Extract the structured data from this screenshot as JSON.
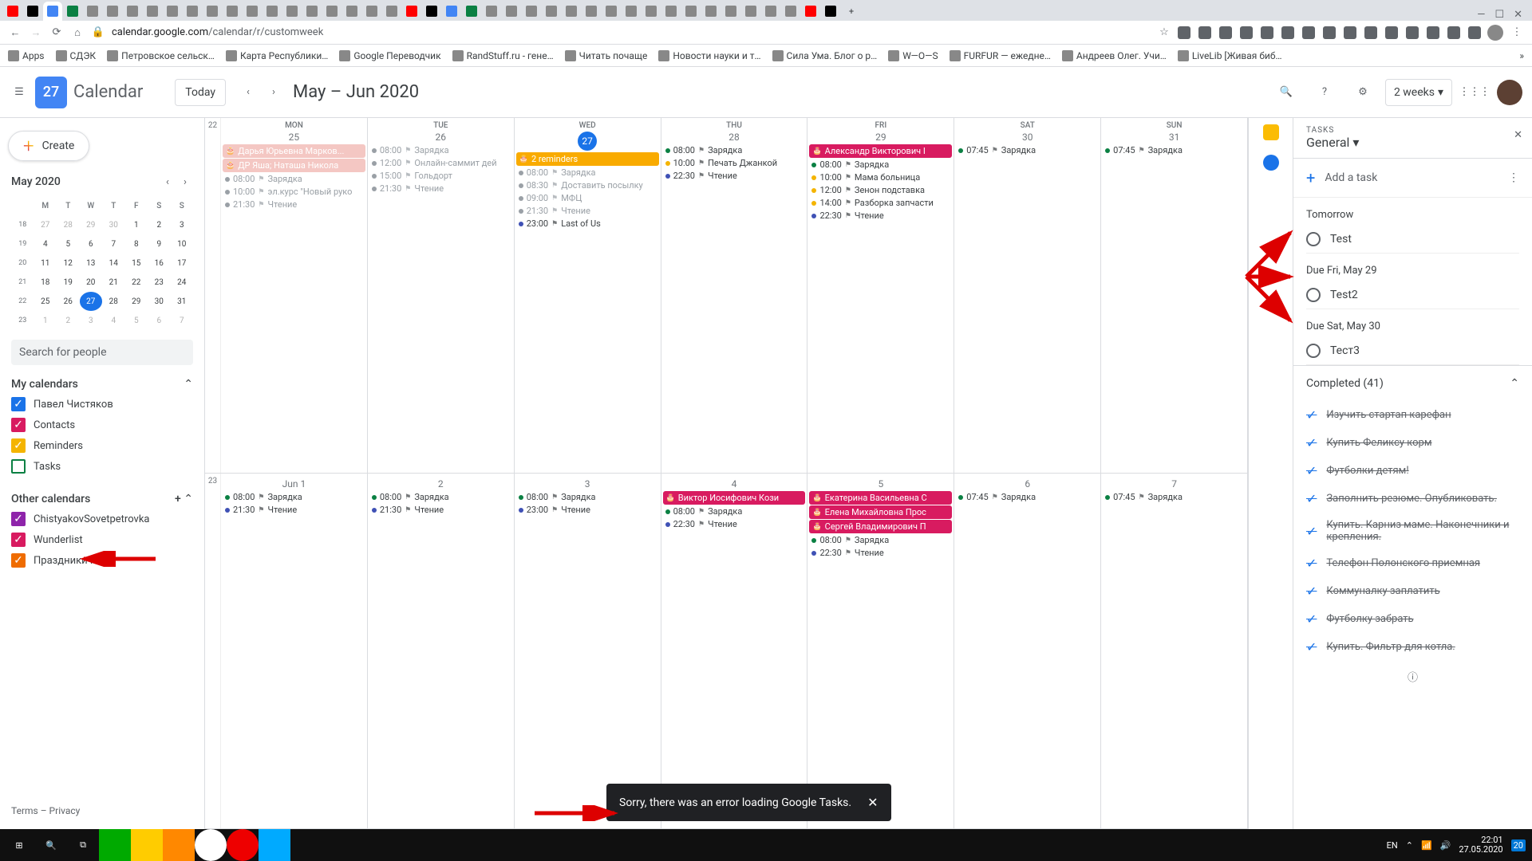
{
  "browser": {
    "url_prefix": "calendar.google.com",
    "url_path": "/calendar/r/customweek",
    "active_tab": "27",
    "addr_icons_count": 15,
    "tab_count": 42
  },
  "bookmarks": [
    "Apps",
    "СДЭК",
    "Петровское сельск…",
    "Карта Республики…",
    "Google Переводчик",
    "RandStuff.ru - гене…",
    "Читать почаще",
    "Новости науки и т…",
    "Сила Ума. Блог о р…",
    "W—O—S",
    "FURFUR — ежедне…",
    "Андреев Олег. Учи…",
    "LiveLib [Живая биб…"
  ],
  "header": {
    "app_title": "Calendar",
    "logo_num": "27",
    "today": "Today",
    "range": "May – Jun 2020",
    "view": "2 weeks"
  },
  "sidebar": {
    "create": "Create",
    "mini_title": "May 2020",
    "dows": [
      "M",
      "T",
      "W",
      "T",
      "F",
      "S",
      "S"
    ],
    "weeks": [
      {
        "wk": "18",
        "days": [
          "27",
          "28",
          "29",
          "30",
          "1",
          "2",
          "3"
        ],
        "muted": [
          0,
          1,
          2,
          3
        ]
      },
      {
        "wk": "19",
        "days": [
          "4",
          "5",
          "6",
          "7",
          "8",
          "9",
          "10"
        ]
      },
      {
        "wk": "20",
        "days": [
          "11",
          "12",
          "13",
          "14",
          "15",
          "16",
          "17"
        ]
      },
      {
        "wk": "21",
        "days": [
          "18",
          "19",
          "20",
          "21",
          "22",
          "23",
          "24"
        ]
      },
      {
        "wk": "22",
        "days": [
          "25",
          "26",
          "27",
          "28",
          "29",
          "30",
          "31"
        ],
        "today": 2
      },
      {
        "wk": "23",
        "days": [
          "1",
          "2",
          "3",
          "4",
          "5",
          "6",
          "7"
        ],
        "muted": [
          0,
          1,
          2,
          3,
          4,
          5,
          6
        ]
      }
    ],
    "search": "Search for people",
    "my_cal_hdr": "My calendars",
    "my_cals": [
      {
        "label": "Павел Чистяков",
        "color": "#1a73e8",
        "checked": true
      },
      {
        "label": "Contacts",
        "color": "#d81b60",
        "checked": true
      },
      {
        "label": "Reminders",
        "color": "#f4b400",
        "checked": true
      },
      {
        "label": "Tasks",
        "color": "#0b8043",
        "checked": false
      }
    ],
    "other_hdr": "Other calendars",
    "other_cals": [
      {
        "label": "ChistyakovSovetpetrovka",
        "color": "#8e24aa",
        "checked": true
      },
      {
        "label": "Wunderlist",
        "color": "#d81b60",
        "checked": true
      },
      {
        "label": "Праздники РФ",
        "color": "#ef6c00",
        "checked": true
      }
    ],
    "footer": "Terms – Privacy"
  },
  "calendar": {
    "week1": {
      "wk": "22",
      "days": [
        {
          "dow": "MON",
          "num": "25",
          "today": false,
          "events": [
            {
              "type": "chip",
              "color": "#f4c7c3",
              "text": "Дарья Юрьевна Марков..."
            },
            {
              "type": "chip",
              "color": "#f4c7c3",
              "text": "ДР Яша; Наташа Никола"
            },
            {
              "type": "dot",
              "dot": "#9aa0a6",
              "time": "08:00",
              "text": "Зарядка",
              "past": true
            },
            {
              "type": "dot",
              "dot": "#9aa0a6",
              "time": "10:00",
              "text": "эл.курс \"Новый руко",
              "past": true
            },
            {
              "type": "dot",
              "dot": "#9aa0a6",
              "time": "21:30",
              "text": "Чтение",
              "past": true
            }
          ]
        },
        {
          "dow": "TUE",
          "num": "26",
          "events": [
            {
              "type": "dot",
              "dot": "#9aa0a6",
              "time": "08:00",
              "text": "Зарядка",
              "past": true
            },
            {
              "type": "dot",
              "dot": "#9aa0a6",
              "time": "12:00",
              "text": "Онлайн-саммит дей",
              "past": true
            },
            {
              "type": "dot",
              "dot": "#9aa0a6",
              "time": "15:00",
              "text": "Гольдорт",
              "past": true
            },
            {
              "type": "dot",
              "dot": "#9aa0a6",
              "time": "21:30",
              "text": "Чтение",
              "past": true
            }
          ]
        },
        {
          "dow": "WED",
          "num": "27",
          "today": true,
          "events": [
            {
              "type": "chip",
              "color": "#f9ab00",
              "text": "2 reminders"
            },
            {
              "type": "dot",
              "dot": "#9aa0a6",
              "time": "08:00",
              "text": "Зарядка",
              "past": true
            },
            {
              "type": "dot",
              "dot": "#9aa0a6",
              "time": "08:30",
              "text": "Доставить посылку",
              "past": true
            },
            {
              "type": "dot",
              "dot": "#9aa0a6",
              "time": "09:00",
              "text": "МФЦ",
              "past": true
            },
            {
              "type": "dot",
              "dot": "#9aa0a6",
              "time": "21:30",
              "text": "Чтение",
              "past": true
            },
            {
              "type": "dot",
              "dot": "#3f51b5",
              "time": "23:00",
              "text": "Last of Us"
            }
          ]
        },
        {
          "dow": "THU",
          "num": "28",
          "events": [
            {
              "type": "dot",
              "dot": "#0b8043",
              "time": "08:00",
              "text": "Зарядка"
            },
            {
              "type": "dot",
              "dot": "#f4b400",
              "time": "10:00",
              "text": "Печать Джанкой"
            },
            {
              "type": "dot",
              "dot": "#3f51b5",
              "time": "22:30",
              "text": "Чтение"
            }
          ]
        },
        {
          "dow": "FRI",
          "num": "29",
          "events": [
            {
              "type": "chip",
              "color": "#d81b60",
              "text": "Александр Викторович I"
            },
            {
              "type": "dot",
              "dot": "#0b8043",
              "time": "08:00",
              "text": "Зарядка"
            },
            {
              "type": "dot",
              "dot": "#f4b400",
              "time": "10:00",
              "text": "Мама больница"
            },
            {
              "type": "dot",
              "dot": "#f4b400",
              "time": "12:00",
              "text": "Зенон подставка"
            },
            {
              "type": "dot",
              "dot": "#f4b400",
              "time": "14:00",
              "text": "Разборка запчасти"
            },
            {
              "type": "dot",
              "dot": "#3f51b5",
              "time": "22:30",
              "text": "Чтение"
            }
          ]
        },
        {
          "dow": "SAT",
          "num": "30",
          "events": [
            {
              "type": "dot",
              "dot": "#0b8043",
              "time": "07:45",
              "text": "Зарядка"
            }
          ]
        },
        {
          "dow": "SUN",
          "num": "31",
          "events": [
            {
              "type": "dot",
              "dot": "#0b8043",
              "time": "07:45",
              "text": "Зарядка"
            }
          ]
        }
      ]
    },
    "week2": {
      "wk": "23",
      "days": [
        {
          "dow": "",
          "num": "Jun 1",
          "events": [
            {
              "type": "dot",
              "dot": "#0b8043",
              "time": "08:00",
              "text": "Зарядка"
            },
            {
              "type": "dot",
              "dot": "#3f51b5",
              "time": "21:30",
              "text": "Чтение"
            }
          ]
        },
        {
          "dow": "",
          "num": "2",
          "events": [
            {
              "type": "dot",
              "dot": "#0b8043",
              "time": "08:00",
              "text": "Зарядка"
            },
            {
              "type": "dot",
              "dot": "#3f51b5",
              "time": "21:30",
              "text": "Чтение"
            }
          ]
        },
        {
          "dow": "",
          "num": "3",
          "events": [
            {
              "type": "dot",
              "dot": "#0b8043",
              "time": "08:00",
              "text": "Зарядка"
            },
            {
              "type": "dot",
              "dot": "#3f51b5",
              "time": "23:00",
              "text": "Чтение"
            }
          ]
        },
        {
          "dow": "",
          "num": "4",
          "events": [
            {
              "type": "chip",
              "color": "#d81b60",
              "text": "Виктор Иосифович Кози"
            },
            {
              "type": "dot",
              "dot": "#0b8043",
              "time": "08:00",
              "text": "Зарядка"
            },
            {
              "type": "dot",
              "dot": "#3f51b5",
              "time": "22:30",
              "text": "Чтение"
            }
          ]
        },
        {
          "dow": "",
          "num": "5",
          "events": [
            {
              "type": "chip",
              "color": "#d81b60",
              "text": "Екатерина Васильевна С"
            },
            {
              "type": "chip",
              "color": "#d81b60",
              "text": "Елена Михайловна Прос"
            },
            {
              "type": "chip",
              "color": "#d81b60",
              "text": "Сергей Владимирович П"
            },
            {
              "type": "dot",
              "dot": "#0b8043",
              "time": "08:00",
              "text": "Зарядка"
            },
            {
              "type": "dot",
              "dot": "#3f51b5",
              "time": "22:30",
              "text": "Чтение"
            }
          ]
        },
        {
          "dow": "",
          "num": "6",
          "events": [
            {
              "type": "dot",
              "dot": "#0b8043",
              "time": "07:45",
              "text": "Зарядка"
            }
          ]
        },
        {
          "dow": "",
          "num": "7",
          "events": [
            {
              "type": "dot",
              "dot": "#0b8043",
              "time": "07:45",
              "text": "Зарядка"
            }
          ]
        }
      ]
    }
  },
  "tasks": {
    "label": "TASKS",
    "list": "General",
    "add": "Add a task",
    "groups": [
      {
        "title": "Tomorrow",
        "items": [
          "Test"
        ]
      },
      {
        "title": "Due Fri, May 29",
        "items": [
          "Test2"
        ]
      },
      {
        "title": "Due Sat, May 30",
        "items": [
          "Тест3"
        ]
      }
    ],
    "completed_hdr": "Completed (41)",
    "completed": [
      "Изучить стартап карефан",
      "Купить Феликсу корм",
      "Футболки детям!",
      "Заполнить резюме. Опубликовать.",
      "Купить. Карниз маме. Наконечники и крепления.",
      "Телефон Полонского приемная",
      "Коммуналку заплатить",
      "Футболку забрать",
      "Купить. Фильтр для котла."
    ]
  },
  "toast": "Sorry, there was an error loading Google Tasks.",
  "taskbar": {
    "lang": "EN",
    "time": "22:01",
    "date": "27.05.2020",
    "notif": "20"
  }
}
